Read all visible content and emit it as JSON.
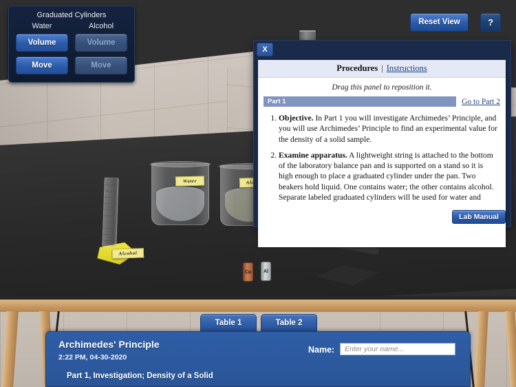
{
  "app": {
    "title": "Archimedes' Principle",
    "timestamp": "2:22 PM, 04-30-2020",
    "subtitle": "Part 1, Investigation; Density of a Solid"
  },
  "toolbar": {
    "reset_view_label": "Reset View",
    "help_label": "?"
  },
  "cylinder_panel": {
    "title": "Graduated Cylinders",
    "columns": [
      {
        "header": "Water",
        "volume_label": "Volume",
        "move_label": "Move",
        "enabled": true
      },
      {
        "header": "Alcohol",
        "volume_label": "Volume",
        "move_label": "Move",
        "enabled": false
      }
    ]
  },
  "procedures": {
    "close_label": "X",
    "tab_procedures": "Procedures",
    "separator": "|",
    "tab_instructions": "Instructions",
    "drag_hint": "Drag this panel to reposition it.",
    "part_label": "Part 1",
    "goto_label": "Go to Part 2",
    "steps": [
      {
        "lead": "Objective.",
        "text": " In Part 1 you will investigate Archimedes’ Principle, and you will use Archimedes’ Principle to find an experimental value for the density of a solid sample."
      },
      {
        "lead": "Examine apparatus.",
        "text": " A lightweight string is attached to the bottom of the laboratory balance pan and is supported on a stand so it is high enough to place a graduated cylinder under the pan. Two beakers hold liquid. One contains water; the other contains alcohol. Separate labeled graduated cylinders will be used for water and"
      }
    ],
    "lab_manual_label": "Lab Manual"
  },
  "tabs": [
    {
      "label": "Table 1",
      "active": true
    },
    {
      "label": "Table 2",
      "active": false
    }
  ],
  "name_field": {
    "label": "Name:",
    "value": "",
    "placeholder": "Enter your name..."
  },
  "scene": {
    "beaker_water_tag": "Water",
    "beaker_alcohol_tag": "Alcohol",
    "cylinder_tag": "Alcohol",
    "sample_copper": "Cu",
    "sample_aluminum": "Al"
  },
  "colors": {
    "accent_blue": "#2a5aa8",
    "panel_dark": "#15233f",
    "panel_body": "#2f5ea6",
    "tag_yellow": "#f2ea92",
    "part_bar": "#8094c0"
  }
}
